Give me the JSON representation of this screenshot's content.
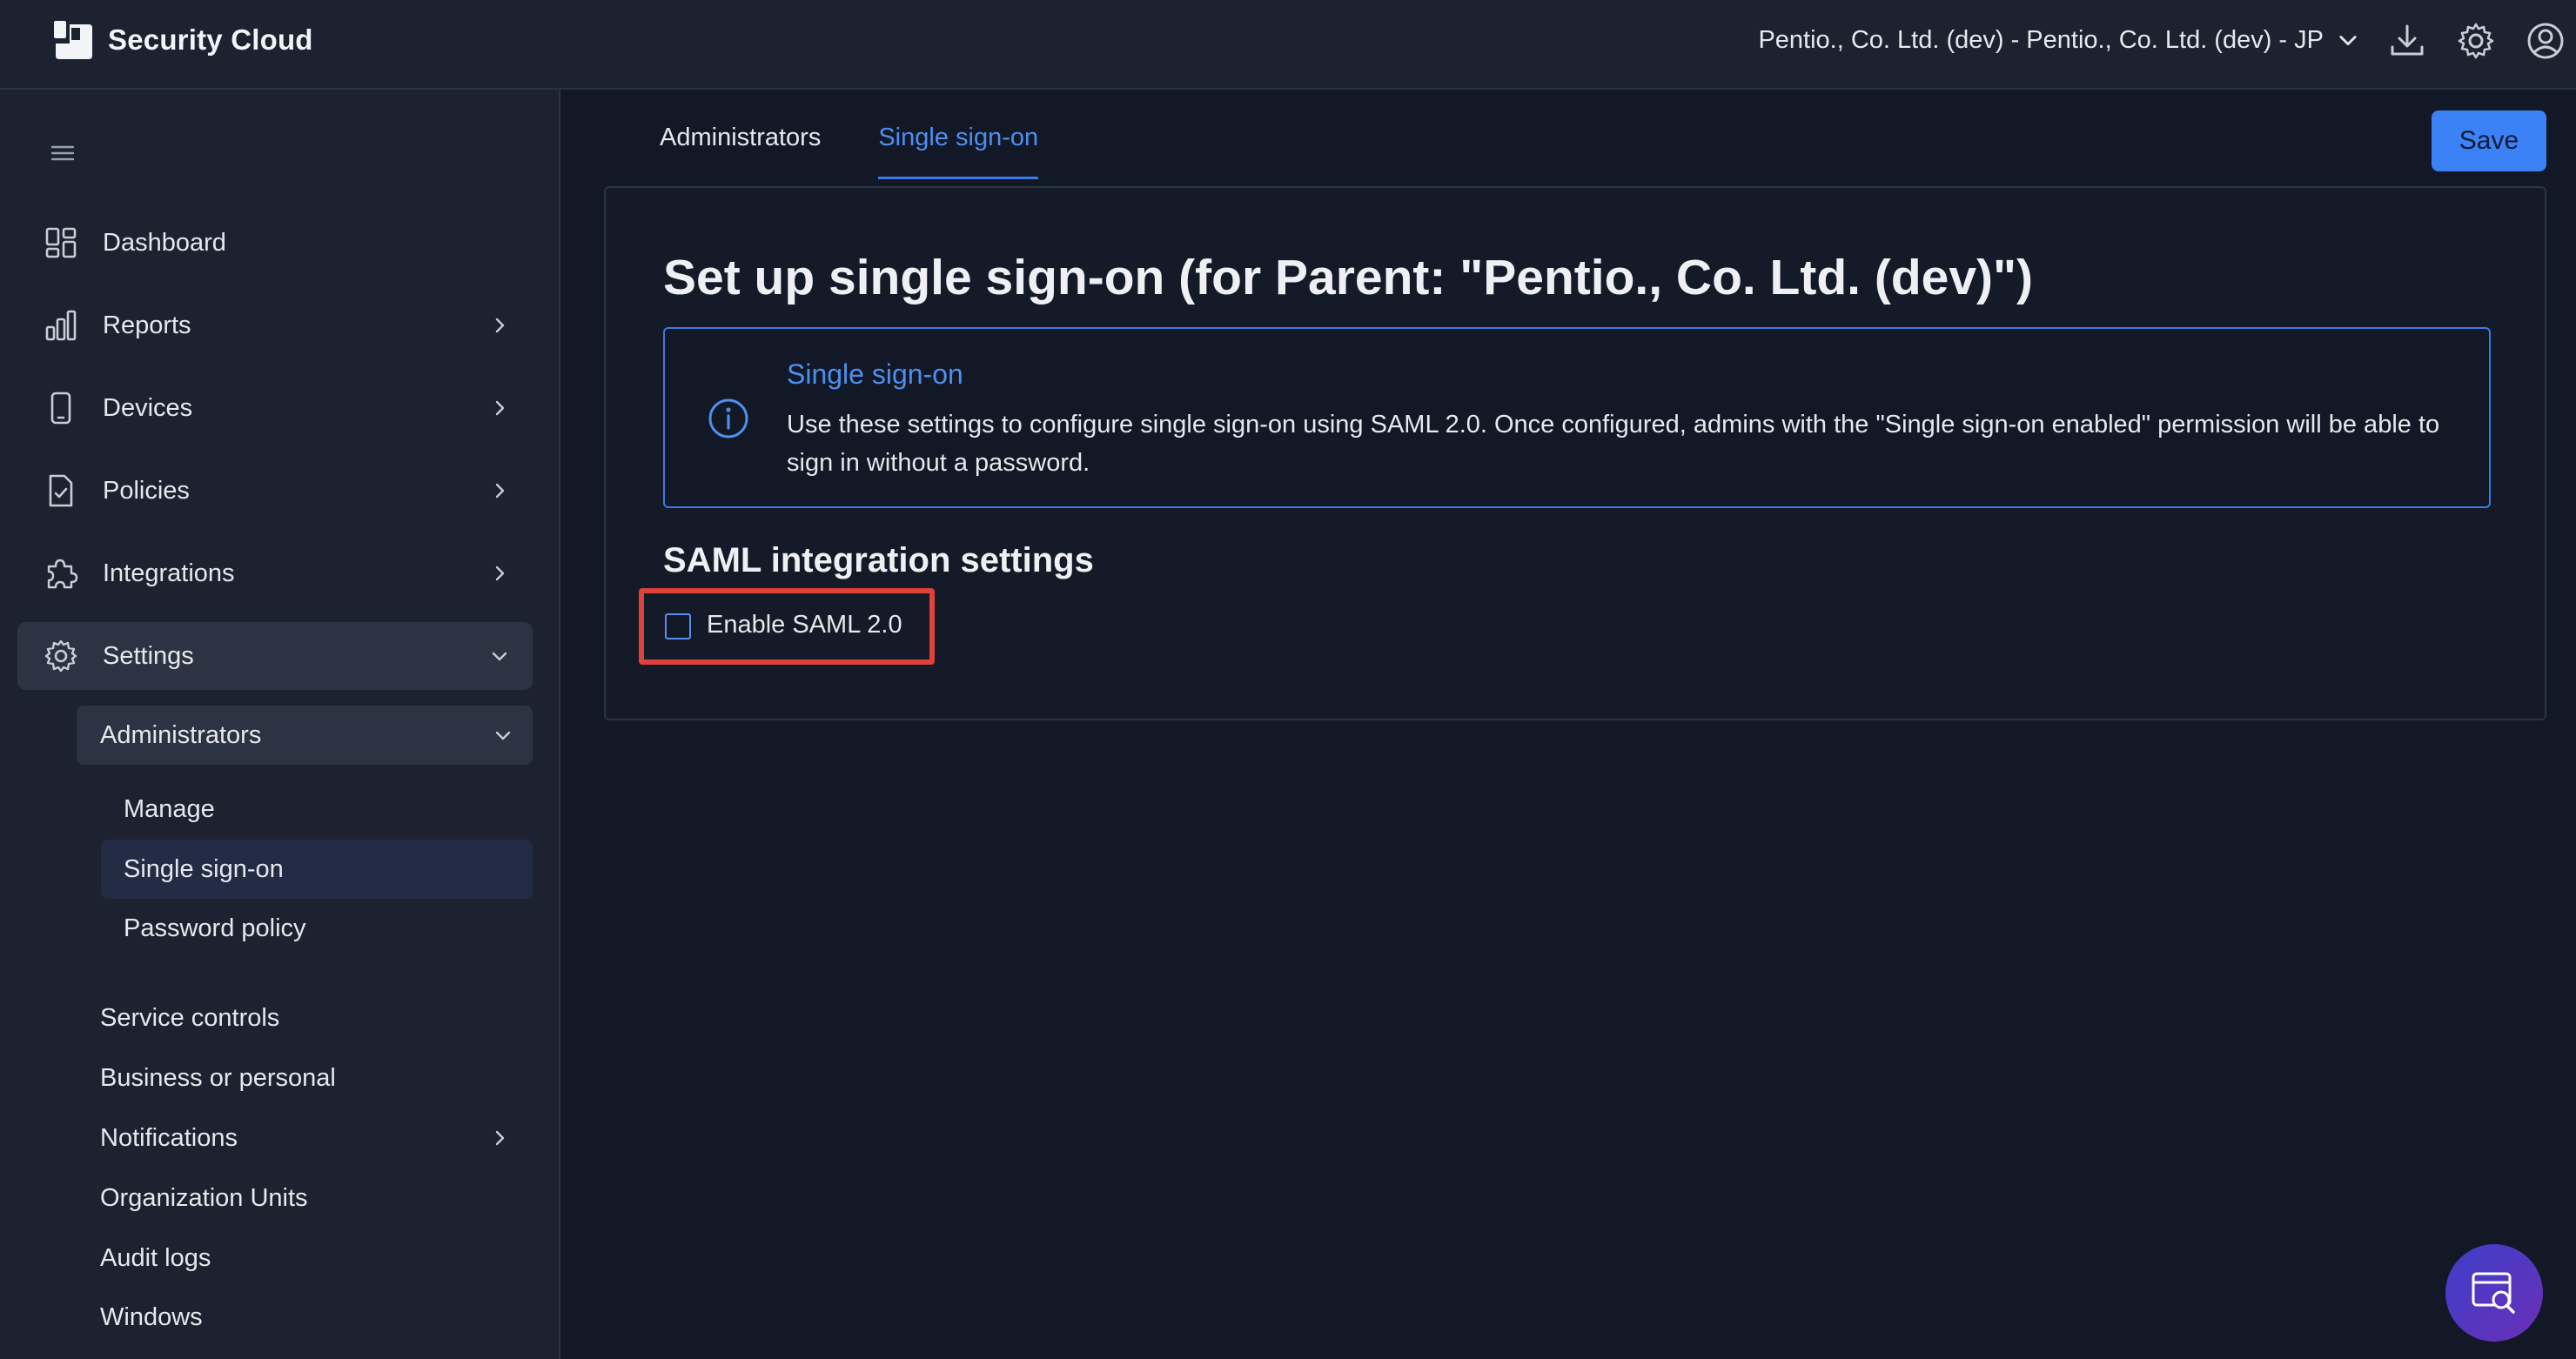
{
  "app": {
    "brand": "Security Cloud"
  },
  "header": {
    "org_selector": "Pentio., Co. Ltd. (dev) - Pentio., Co. Ltd. (dev) - JP",
    "icons": [
      "download-icon",
      "gear-icon",
      "user-icon"
    ]
  },
  "sidebar": {
    "items": [
      {
        "label": "Dashboard",
        "icon": "dashboard-icon"
      },
      {
        "label": "Reports",
        "icon": "bar-chart-icon"
      },
      {
        "label": "Devices",
        "icon": "phone-icon"
      },
      {
        "label": "Policies",
        "icon": "policy-document-icon"
      },
      {
        "label": "Integrations",
        "icon": "puzzle-icon"
      },
      {
        "label": "Settings",
        "icon": "gear-icon"
      }
    ],
    "administrators": {
      "label": "Administrators",
      "children": [
        "Manage",
        "Single sign-on",
        "Password policy"
      ],
      "selected": "Single sign-on"
    },
    "settings_children": [
      "Service controls",
      "Business or personal",
      "Notifications",
      "Organization Units",
      "Audit logs",
      "Windows"
    ]
  },
  "main": {
    "tabs": [
      {
        "label": "Administrators",
        "active": false
      },
      {
        "label": "Single sign-on",
        "active": true
      }
    ],
    "save_label": "Save",
    "title": "Set up single sign-on (for Parent: \"Pentio., Co. Ltd. (dev)\")",
    "info": {
      "title": "Single sign-on",
      "body": "Use these settings to configure single sign-on using SAML 2.0. Once configured, admins with the \"Single sign-on enabled\" permission will be able to sign in without a password."
    },
    "section_title": "SAML integration settings",
    "saml_checkbox": {
      "label": "Enable SAML 2.0",
      "checked": false
    }
  },
  "colors": {
    "accent": "#3b82f6",
    "highlight": "#e0413a",
    "background": "#121826",
    "chrome": "#1c2230"
  }
}
